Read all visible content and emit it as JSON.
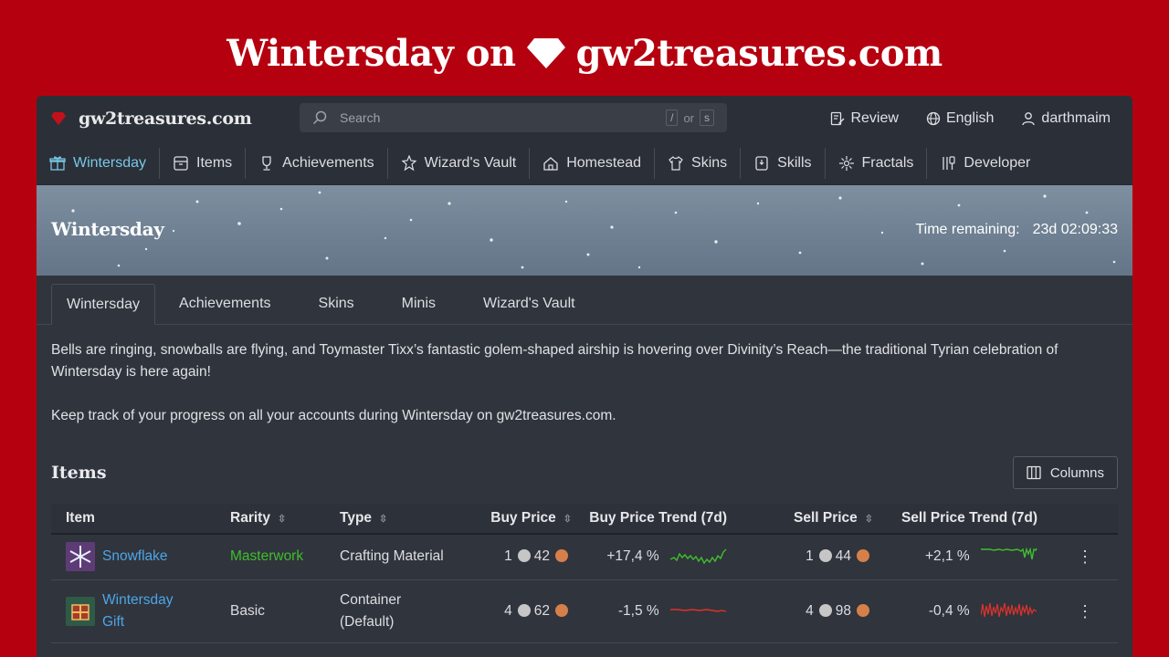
{
  "banner": {
    "title_prefix": "Wintersday on",
    "title_site": "gw2treasures.com"
  },
  "topbar": {
    "logo_text": "gw2treasures.com",
    "search_placeholder": "Search",
    "search_hint_key1": "/",
    "search_hint_or": "or",
    "search_hint_key2": "s",
    "review_label": "Review",
    "language_label": "English",
    "user_label": "darthmaim"
  },
  "nav": [
    {
      "label": "Wintersday",
      "icon": "gift-icon",
      "active": true
    },
    {
      "label": "Items",
      "icon": "box-icon"
    },
    {
      "label": "Achievements",
      "icon": "trophy-icon"
    },
    {
      "label": "Wizard's Vault",
      "icon": "vault-icon"
    },
    {
      "label": "Homestead",
      "icon": "home-icon"
    },
    {
      "label": "Skins",
      "icon": "shirt-icon"
    },
    {
      "label": "Skills",
      "icon": "skill-icon"
    },
    {
      "label": "Fractals",
      "icon": "fractal-icon"
    },
    {
      "label": "Developer",
      "icon": "tools-icon"
    }
  ],
  "hero": {
    "title": "Wintersday",
    "remaining_label": "Time remaining:",
    "remaining_value": "23d 02:09:33"
  },
  "tabs": [
    "Wintersday",
    "Achievements",
    "Skins",
    "Minis",
    "Wizard's Vault"
  ],
  "content": {
    "para1": "Bells are ringing, snowballs are flying, and Toymaster Tixx’s fantastic golem-shaped airship is hovering over Divinity’s Reach—the traditional Tyrian celebration of Wintersday is here again!",
    "para2": "Keep track of your progress on all your accounts during Wintersday on gw2treasures.com."
  },
  "items": {
    "heading": "Items",
    "columns_button": "Columns",
    "headers": {
      "item": "Item",
      "rarity": "Rarity",
      "type": "Type",
      "buy_price": "Buy Price",
      "buy_trend": "Buy Price Trend (7d)",
      "sell_price": "Sell Price",
      "sell_trend": "Sell Price Trend (7d)"
    },
    "rows": [
      {
        "name": "Snowflake",
        "rarity": "Masterwork",
        "type": "Crafting Material",
        "buy_silver": "1",
        "buy_copper": "42",
        "buy_trend": "+17,4 %",
        "sell_silver": "1",
        "sell_copper": "44",
        "sell_trend": "+2,1 %",
        "buy_trend_color": "#3fbe2e",
        "sell_trend_color": "#3fbe2e"
      },
      {
        "name_line1": "Wintersday",
        "name_line2": "Gift",
        "rarity": "Basic",
        "type_line1": "Container",
        "type_line2": "(Default)",
        "buy_silver": "4",
        "buy_copper": "62",
        "buy_trend": "-1,5 %",
        "sell_silver": "4",
        "sell_copper": "98",
        "sell_trend": "-0,4 %",
        "buy_trend_color": "#e0322b",
        "sell_trend_color": "#e0322b"
      }
    ]
  },
  "colors": {
    "background": "#b5000f",
    "panel": "#30343c",
    "accent": "#78c8e8",
    "link": "#4da6e8",
    "masterwork": "#3fbe2e"
  }
}
